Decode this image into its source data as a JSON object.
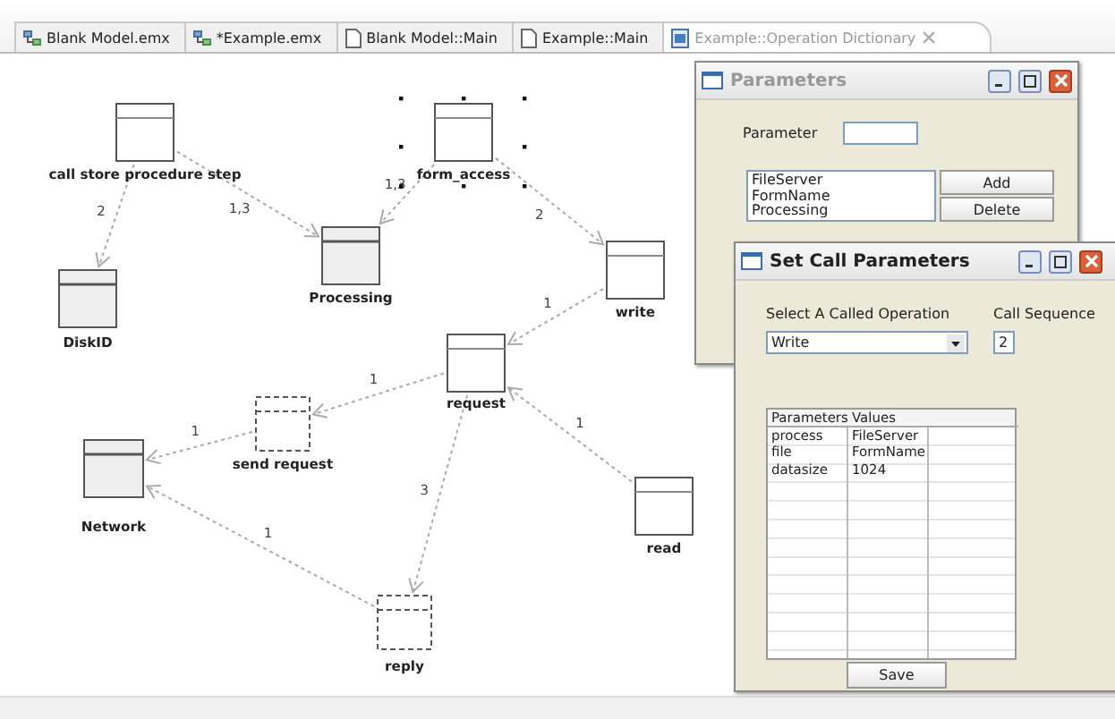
{
  "tabs": [
    {
      "label": "Blank Model.emx",
      "selected": false
    },
    {
      "label": "*Example.emx",
      "selected": false
    },
    {
      "label": "Blank Model::Main",
      "selected": false
    },
    {
      "label": "Example::Main",
      "selected": false
    },
    {
      "label": "Example::Operation Dictionary",
      "selected": true
    }
  ],
  "diagram": {
    "nodes": [
      {
        "label": "call store procedure step",
        "kind": "plain",
        "selected": false
      },
      {
        "label": "form_access",
        "kind": "plain",
        "selected": true
      },
      {
        "label": "Processing",
        "kind": "filled",
        "selected": false
      },
      {
        "label": "DiskID",
        "kind": "filled",
        "selected": false
      },
      {
        "label": "write",
        "kind": "plain",
        "selected": false
      },
      {
        "label": "request",
        "kind": "plain",
        "selected": false
      },
      {
        "label": "send request",
        "kind": "dashed",
        "selected": false
      },
      {
        "label": "Network",
        "kind": "filled",
        "selected": false
      },
      {
        "label": "read",
        "kind": "plain",
        "selected": false
      },
      {
        "label": "reply",
        "kind": "dashed",
        "selected": false
      }
    ],
    "edges": [
      {
        "label": "2"
      },
      {
        "label": "1,3"
      },
      {
        "label": "1,3"
      },
      {
        "label": "2"
      },
      {
        "label": "1"
      },
      {
        "label": "1"
      },
      {
        "label": "1"
      },
      {
        "label": "3"
      },
      {
        "label": "1"
      },
      {
        "label": "1"
      }
    ]
  },
  "parameters_dialog": {
    "title": "Parameters",
    "parameter_label": "Parameter",
    "list_items": [
      "FileServer",
      "FormName",
      "Processing"
    ],
    "buttons": [
      "Add",
      "Delete"
    ]
  },
  "set_call_dialog": {
    "title": "Set Call Parameters",
    "operation_label": "Select A Called Operation",
    "operation_value": "Write",
    "sequence_label": "Call Sequence",
    "sequence_value": "2",
    "table": {
      "columns": [
        "Parameters",
        "Values"
      ],
      "rows": [
        [
          "process",
          "FileServer"
        ],
        [
          "file",
          "FormName"
        ],
        [
          "datasize",
          "1024"
        ]
      ]
    },
    "save_button": "Save"
  }
}
